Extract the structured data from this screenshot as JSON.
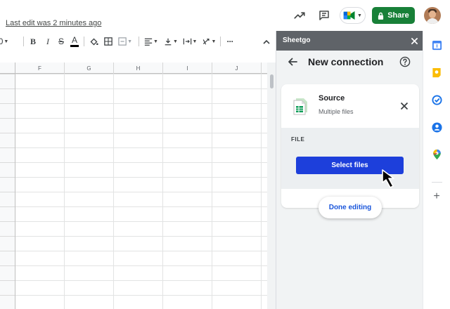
{
  "header": {
    "last_edit": "Last edit was 2 minutes ago",
    "share_label": "Share",
    "share_color": "#188038"
  },
  "toolbar": {
    "font_size_partial": "0",
    "bold": "B",
    "italic": "I",
    "strike": "S",
    "text_color": "A",
    "more": "···"
  },
  "sheet": {
    "columns": [
      "F",
      "G",
      "H",
      "I",
      "J"
    ]
  },
  "panel": {
    "title": "Sheetgo",
    "heading": "New connection",
    "source": {
      "title": "Source",
      "subtitle": "Multiple files"
    },
    "file_label": "FILE",
    "select_files": "Select files",
    "done_editing": "Done editing",
    "accent_color": "#1d3fdb"
  },
  "rail": {
    "icons": [
      "calendar-icon",
      "keep-icon",
      "tasks-icon",
      "contacts-icon",
      "maps-icon",
      "add-icon"
    ],
    "add": "+"
  }
}
